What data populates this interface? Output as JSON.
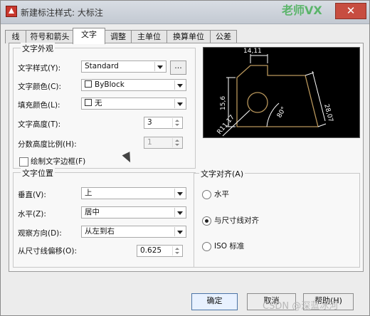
{
  "window": {
    "title": "新建标注样式: 大标注",
    "watermark": "老师VX",
    "close": "✕"
  },
  "tabs": [
    "线",
    "符号和箭头",
    "文字",
    "调整",
    "主单位",
    "换算单位",
    "公差"
  ],
  "text_appearance": {
    "title": "文字外观",
    "style_label": "文字样式(Y):",
    "style_value": "Standard",
    "style_button": "...",
    "color_label": "文字颜色(C):",
    "color_value": "ByBlock",
    "fill_label": "填充颜色(L):",
    "fill_value": "无",
    "height_label": "文字高度(T):",
    "height_value": "3",
    "fraction_label": "分数高度比例(H):",
    "fraction_value": "1",
    "frame_label": "绘制文字边框(F)"
  },
  "text_position": {
    "title": "文字位置",
    "vertical_label": "垂直(V):",
    "vertical_value": "上",
    "horizontal_label": "水平(Z):",
    "horizontal_value": "居中",
    "view_label": "观察方向(D):",
    "view_value": "从左到右",
    "offset_label": "从尺寸线偏移(O):",
    "offset_value": "0.625"
  },
  "text_alignment": {
    "title": "文字对齐(A)",
    "options": [
      "水平",
      "与尺寸线对齐",
      "ISO 标准"
    ],
    "selected": "与尺寸线对齐"
  },
  "preview": {
    "dimension_top": "14,11",
    "dimension_left": "15,6",
    "dimension_right": "28,07",
    "angle": "80°",
    "radius": "R11,17"
  },
  "buttons": {
    "ok": "确定",
    "cancel": "取消",
    "help": "帮助(H)"
  },
  "watermark_bottom": "CSDN @深蓝冰河",
  "colors": {
    "preview_bg": "#000000",
    "drawing": "#b8965b",
    "dimensions": "#ffffff"
  }
}
